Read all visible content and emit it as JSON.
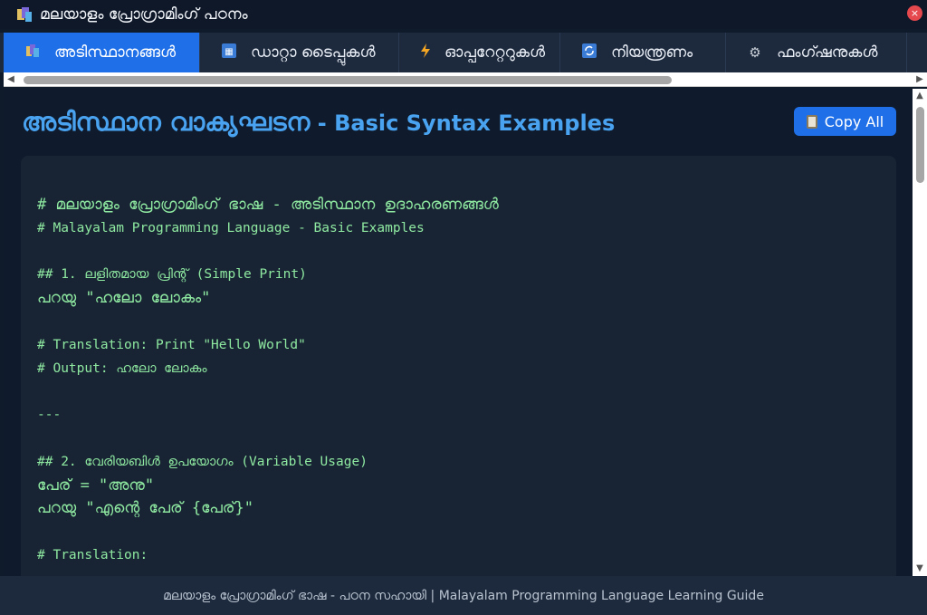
{
  "window": {
    "title": "മലയാളം പ്രോഗ്രാമിംഗ് പഠനം",
    "close_glyph": "×"
  },
  "tabs": [
    {
      "label": "അടിസ്ഥാനങ്ങൾ",
      "icon": "books-icon",
      "active": true
    },
    {
      "label": "ഡാറ്റാ ടൈപ്പുകൾ",
      "icon": "data-grid-icon",
      "active": false
    },
    {
      "label": "ഓപ്പറേറ്ററുകൾ",
      "icon": "lightning-icon",
      "active": false
    },
    {
      "label": "നിയന്ത്രണം",
      "icon": "refresh-icon",
      "active": false
    },
    {
      "label": "ഫംഗ്ഷനുകൾ",
      "icon": "gear-icon",
      "active": false
    }
  ],
  "content": {
    "heading_ml": "അടിസ്ഥാന വാക്യഘടന",
    "heading_en": " - Basic Syntax Examples",
    "copy_label": "Copy All",
    "code_lines": [
      "# മലയാളം പ്രോഗ്രാമിംഗ് ഭാഷ - അടിസ്ഥാന ഉദാഹരണങ്ങൾ",
      "# Malayalam Programming Language - Basic Examples",
      "",
      "## 1. ലളിതമായ പ്രിന്റ് (Simple Print)",
      "പറയു \"ഹലോ ലോകം\"",
      "",
      "# Translation: Print \"Hello World\"",
      "# Output: ഹലോ ലോകം",
      "",
      "---",
      "",
      "## 2. വേരിയബിൾ ഉപയോഗം (Variable Usage)",
      "പേര് = \"അനു\"",
      "പറയു \"എന്റെ പേര് {പേര്}\"",
      "",
      "# Translation:"
    ]
  },
  "footer": {
    "text": "മലയാളം പ്രോഗ്രാമിംഗ് ഭാഷ - പഠന സഹായി | Malayalam Programming Language Learning Guide"
  },
  "colors": {
    "accent": "#1f6fe8",
    "heading": "#4aa3f0",
    "code": "#8ee8a0",
    "background": "#0f1b2c"
  }
}
